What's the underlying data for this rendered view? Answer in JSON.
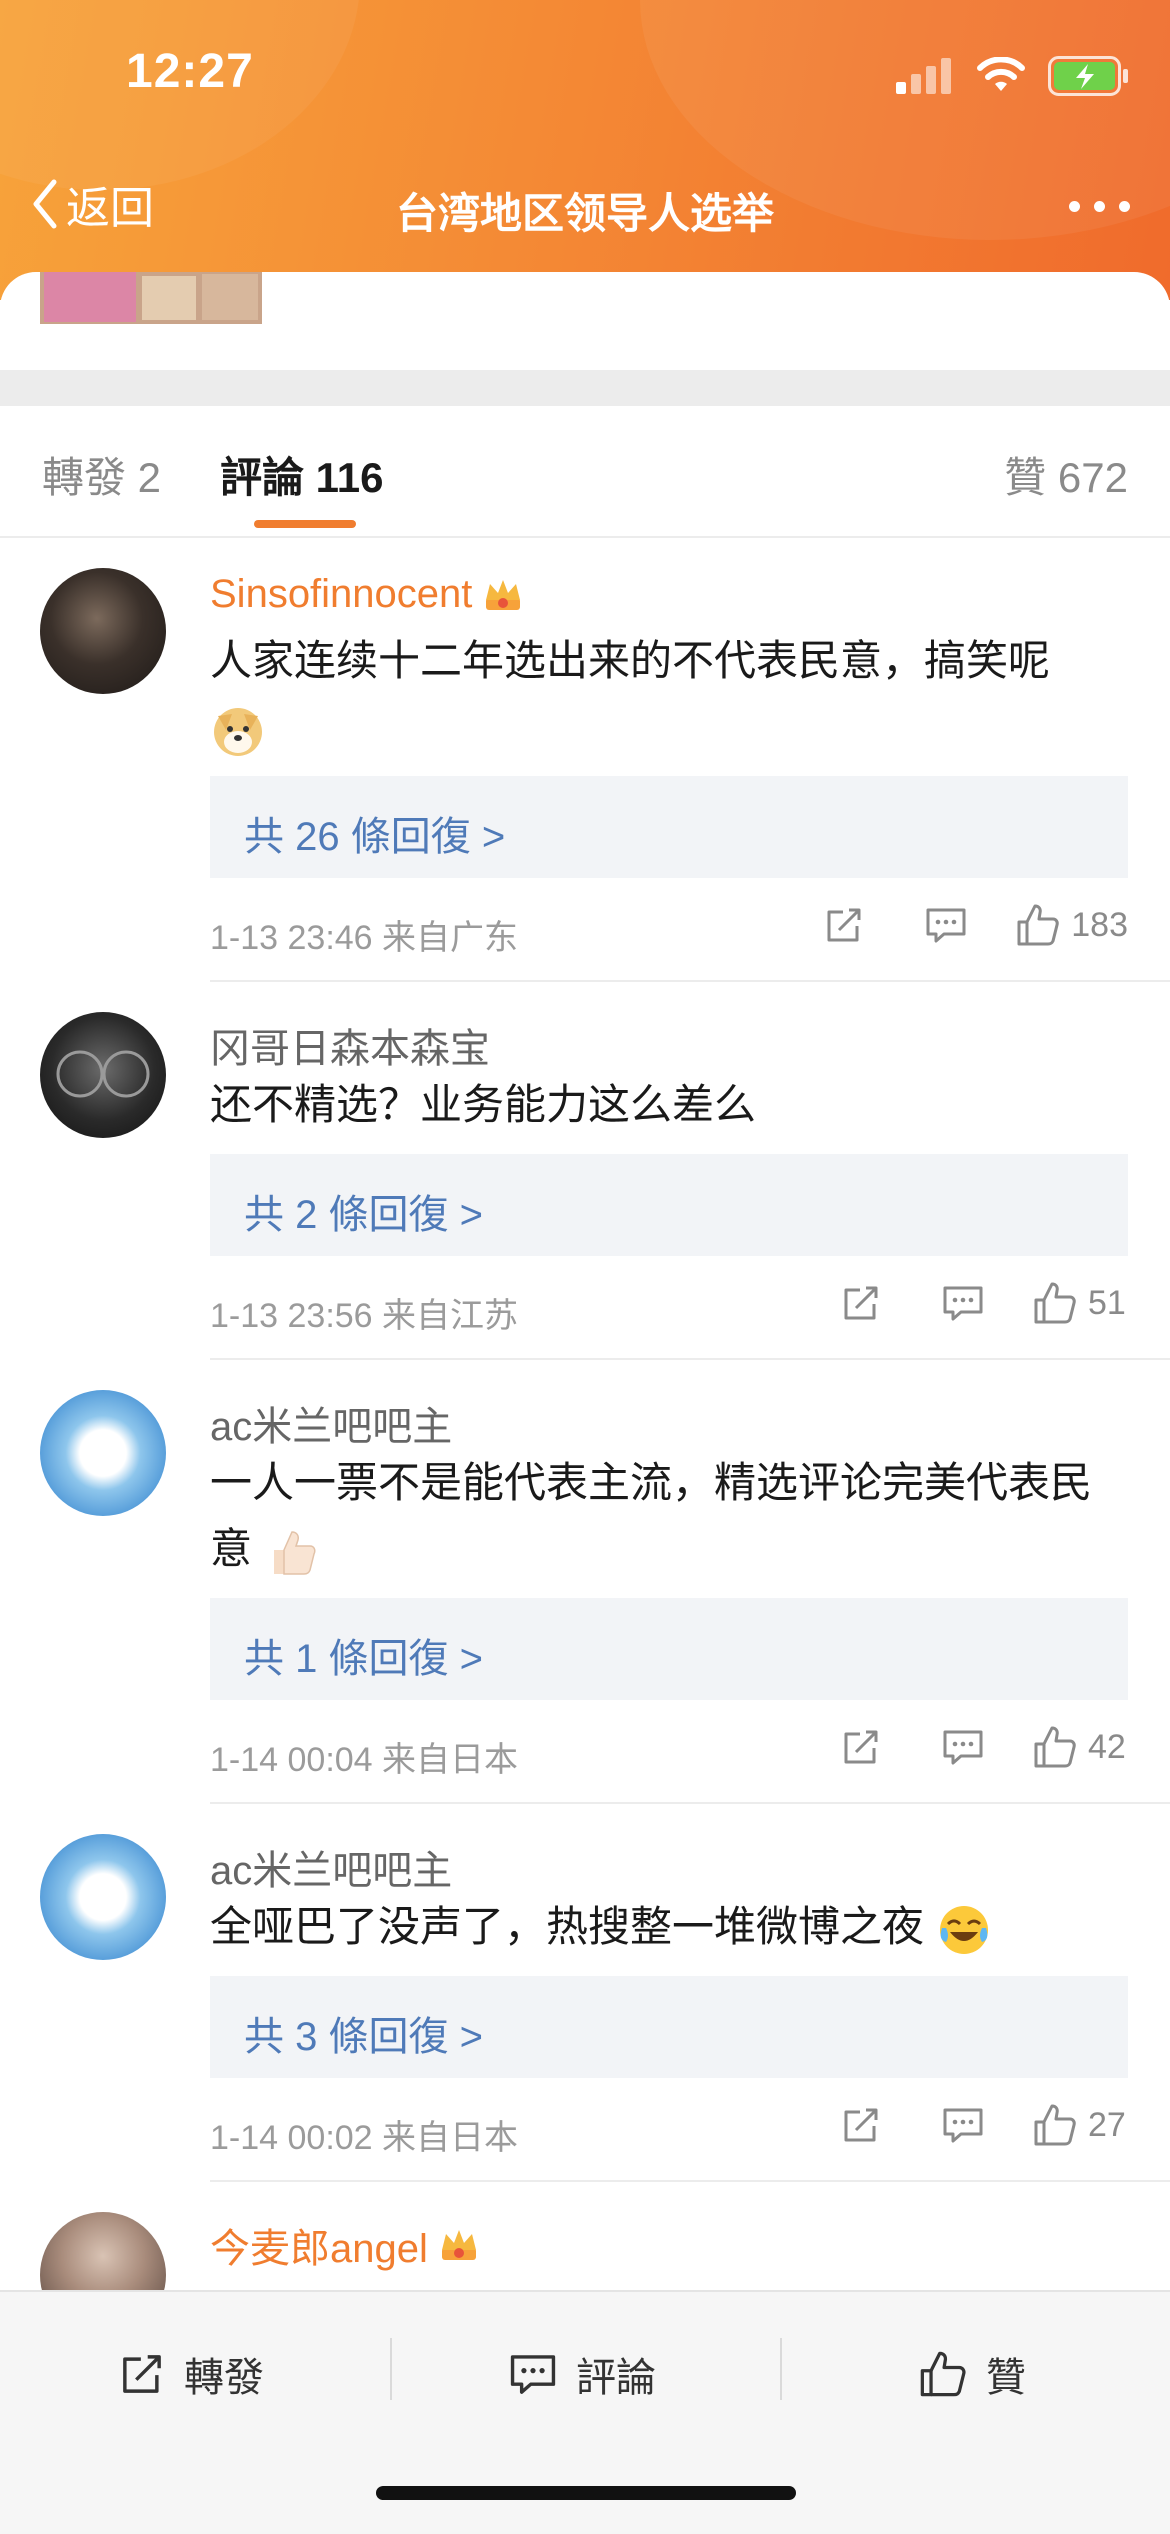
{
  "status_bar": {
    "time": "12:27"
  },
  "nav": {
    "back_label": "返回",
    "title": "台湾地区领导人选举"
  },
  "tabs": {
    "repost": "轉發 2",
    "comments": "評論 116",
    "likes": "贊 672"
  },
  "comments": [
    {
      "author": "Sinsofinnocent",
      "text": "人家连续十二年选出来的不代表民意，搞笑呢",
      "replies": "共 26 條回復 >",
      "time": "1-13 23:46",
      "location": "来自广东",
      "likes": "183"
    },
    {
      "author": "冈哥日森本森宝",
      "text": "还不精选？业务能力这么差么",
      "replies": "共 2 條回復 >",
      "time": "1-13 23:56",
      "location": "来自江苏",
      "likes": "51"
    },
    {
      "author": "ac米兰吧吧主",
      "text": "一人一票不是能代表主流，精选评论完美代表民意",
      "replies": "共 1 條回復 >",
      "time": "1-14 00:04",
      "location": "来自日本",
      "likes": "42"
    },
    {
      "author": "ac米兰吧吧主",
      "text": "全哑巴了没声了，热搜整一堆微博之夜",
      "replies": "共 3 條回復 >",
      "time": "1-14 00:02",
      "location": "来自日本",
      "likes": "27"
    },
    {
      "author": "今麦郎angel",
      "text": ""
    }
  ],
  "bottom_bar": {
    "repost": "轉發",
    "comment": "評論",
    "like": "贊"
  },
  "colors": {
    "accent": "#f07d2f",
    "link": "#4f7ab8",
    "header_start": "#f7a33a",
    "header_end": "#f06b2c"
  },
  "icons": [
    "signal-icon",
    "wifi-icon",
    "battery-charging-icon",
    "back-chevron-icon",
    "more-icon",
    "crown-icon",
    "doge-emoji-icon",
    "thumbs-up-emoji-icon",
    "laugh-cry-emoji-icon",
    "share-icon",
    "comment-icon",
    "like-icon"
  ]
}
